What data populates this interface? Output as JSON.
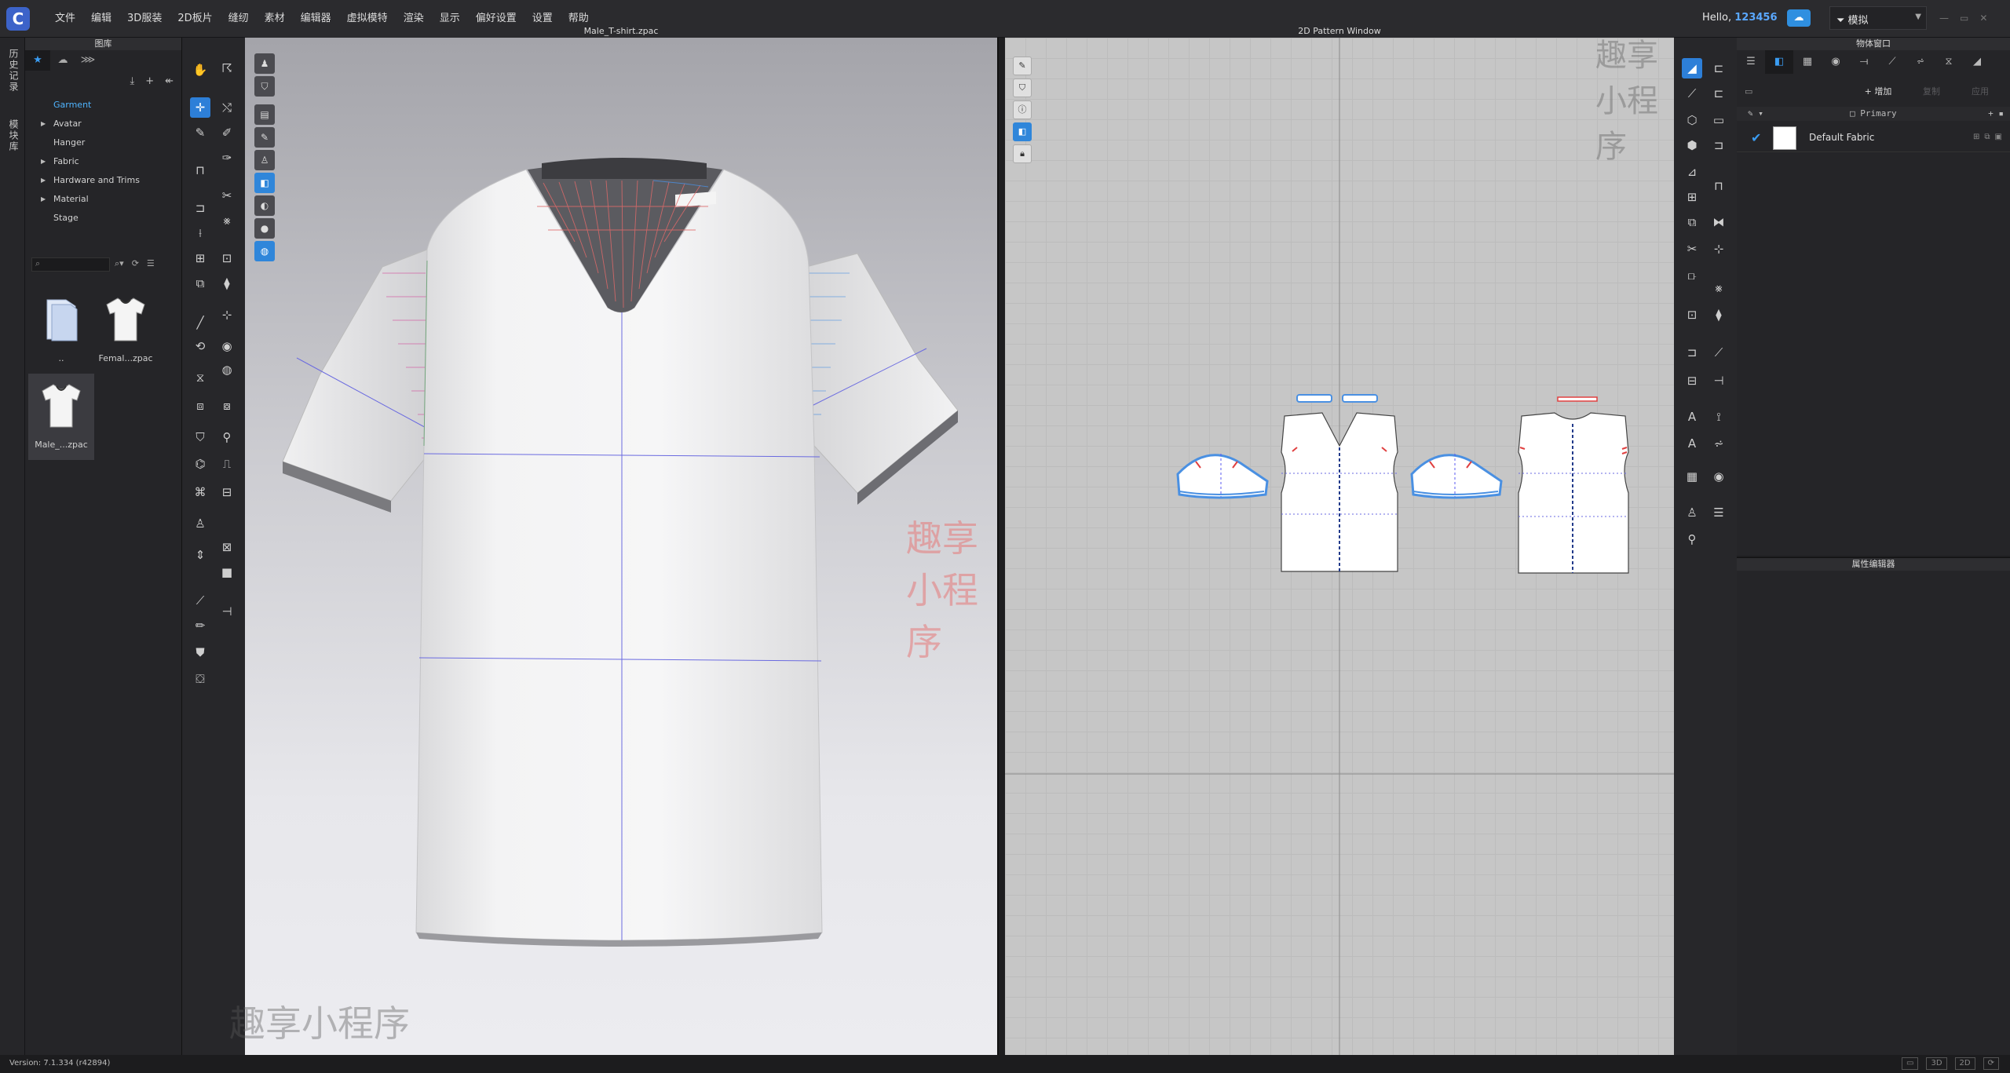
{
  "menubar": {
    "items": [
      "文件",
      "编辑",
      "3D服装",
      "2D板片",
      "缝纫",
      "素材",
      "编辑器",
      "虚拟模特",
      "渲染",
      "显示",
      "偏好设置",
      "设置",
      "帮助"
    ],
    "hello_prefix": "Hello,",
    "username": "123456",
    "mode": "模拟"
  },
  "side_strip": {
    "tabs": [
      "历史记录",
      "模块库"
    ]
  },
  "library": {
    "title": "图库",
    "tree": [
      {
        "label": "Garment",
        "expandable": false,
        "selected": true
      },
      {
        "label": "Avatar",
        "expandable": true
      },
      {
        "label": "Hanger",
        "expandable": false
      },
      {
        "label": "Fabric",
        "expandable": true
      },
      {
        "label": "Hardware and Trims",
        "expandable": true
      },
      {
        "label": "Material",
        "expandable": true
      },
      {
        "label": "Stage",
        "expandable": false
      }
    ],
    "thumbnails": [
      {
        "caption": "..",
        "icon": "folder-icon"
      },
      {
        "caption": "Femal...zpac",
        "icon": "tshirt-icon"
      },
      {
        "caption": "Male_...zpac",
        "icon": "tshirt-icon",
        "selected": true
      }
    ]
  },
  "view3d": {
    "title": "Male_T-shirt.zpac"
  },
  "view2d": {
    "title": "2D Pattern Window"
  },
  "object_window": {
    "title": "物体窗口",
    "add_label": "+ 增加",
    "copy_label": "复制",
    "apply_label": "应用",
    "primary_label": "Primary",
    "fabric_name": "Default Fabric"
  },
  "property_editor": {
    "title": "属性编辑器"
  },
  "watermarks": {
    "center": "趣享小程序",
    "bottom_left": "趣享小程序",
    "top_right": "趣享小程序"
  },
  "status": {
    "version": "Version: 7.1.334 (r42894)"
  },
  "colors": {
    "accent": "#3a9cf2",
    "seam_blue": "#4a90e2",
    "seam_red": "#e05050"
  }
}
